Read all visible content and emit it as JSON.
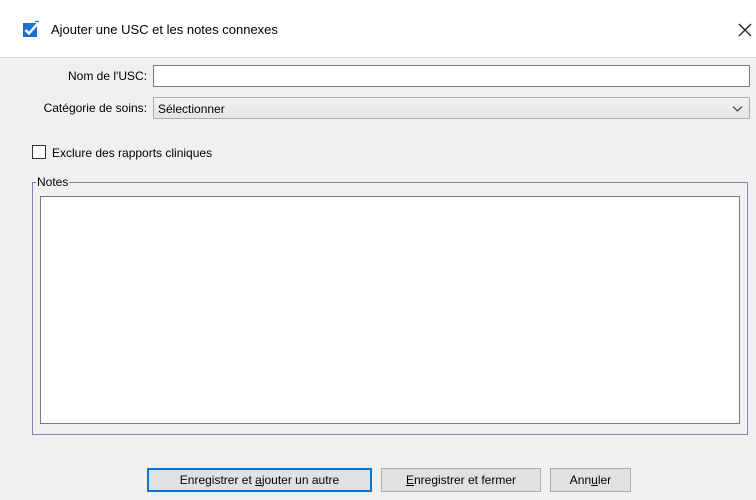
{
  "window": {
    "title": "Ajouter une USC et les notes connexes",
    "close_glyph": "✕",
    "title_icon": "checkbox-checked-icon",
    "accent_color": "#1e6fd0"
  },
  "form": {
    "name_label": "Nom de l'USC:",
    "name_value": "",
    "category_label": "Catégorie de soins:",
    "category_selected": "Sélectionner",
    "exclude_label": "Exclure des rapports cliniques",
    "exclude_checked": false,
    "notes_legend": "Notes",
    "notes_value": ""
  },
  "buttons": {
    "save_add": {
      "pre": "Enregistrer et ",
      "mnemonic": "a",
      "post": "jouter un autre"
    },
    "save_close": {
      "pre": "",
      "mnemonic": "E",
      "post": "nregistrer et fermer"
    },
    "cancel": {
      "pre": "Ann",
      "mnemonic": "u",
      "post": "ler"
    }
  }
}
